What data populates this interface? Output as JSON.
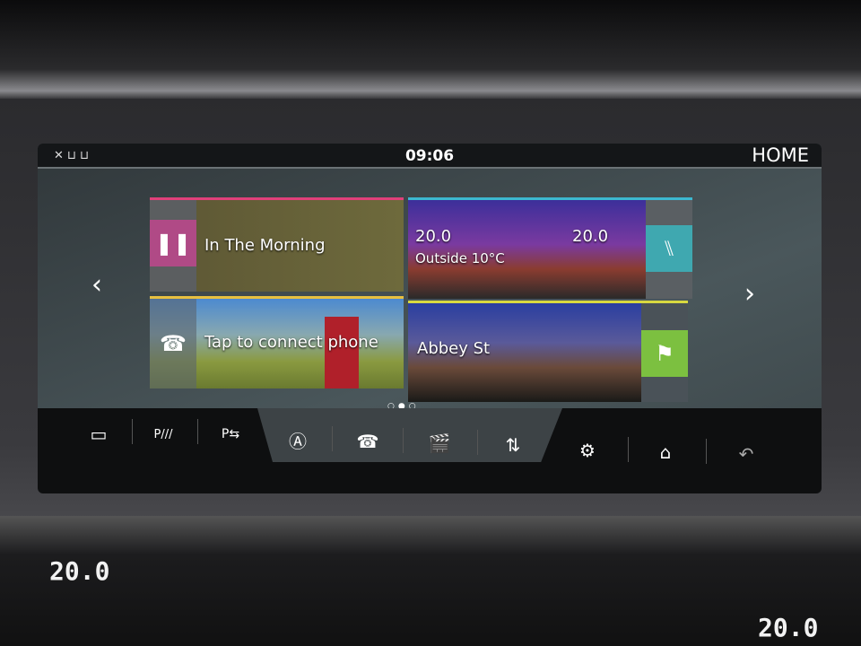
{
  "header": {
    "time": "09:06",
    "title": "HOME",
    "status_icons": [
      "parking-sensor-icon",
      "seat-icon"
    ]
  },
  "tiles": [
    {
      "id": "media",
      "label": "In The Morning",
      "icon": "pause-icon",
      "accent": "#e0407a"
    },
    {
      "id": "climate",
      "left_temp": "20.0",
      "right_temp": "20.0",
      "outside": "Outside 10°C",
      "icon": "seat-icon",
      "accent": "#3cb8d0"
    },
    {
      "id": "phone",
      "label": "Tap to connect phone",
      "icon": "phone-icon",
      "accent": "#e8c040"
    },
    {
      "id": "navigation",
      "label": "Abbey St",
      "icon": "checkered-flag-icon",
      "accent": "#d8d840"
    }
  ],
  "pager": {
    "pages": 3,
    "current": 2
  },
  "nav_bar": [
    "camera-icon",
    "parking-aid-icon",
    "park-assist-icon",
    "navigation-icon",
    "phone-icon",
    "media-icon",
    "climate-icon",
    "settings-icon",
    "home-icon",
    "back-icon"
  ],
  "console": {
    "left_temp": "20.0",
    "right_temp": "20.0"
  }
}
